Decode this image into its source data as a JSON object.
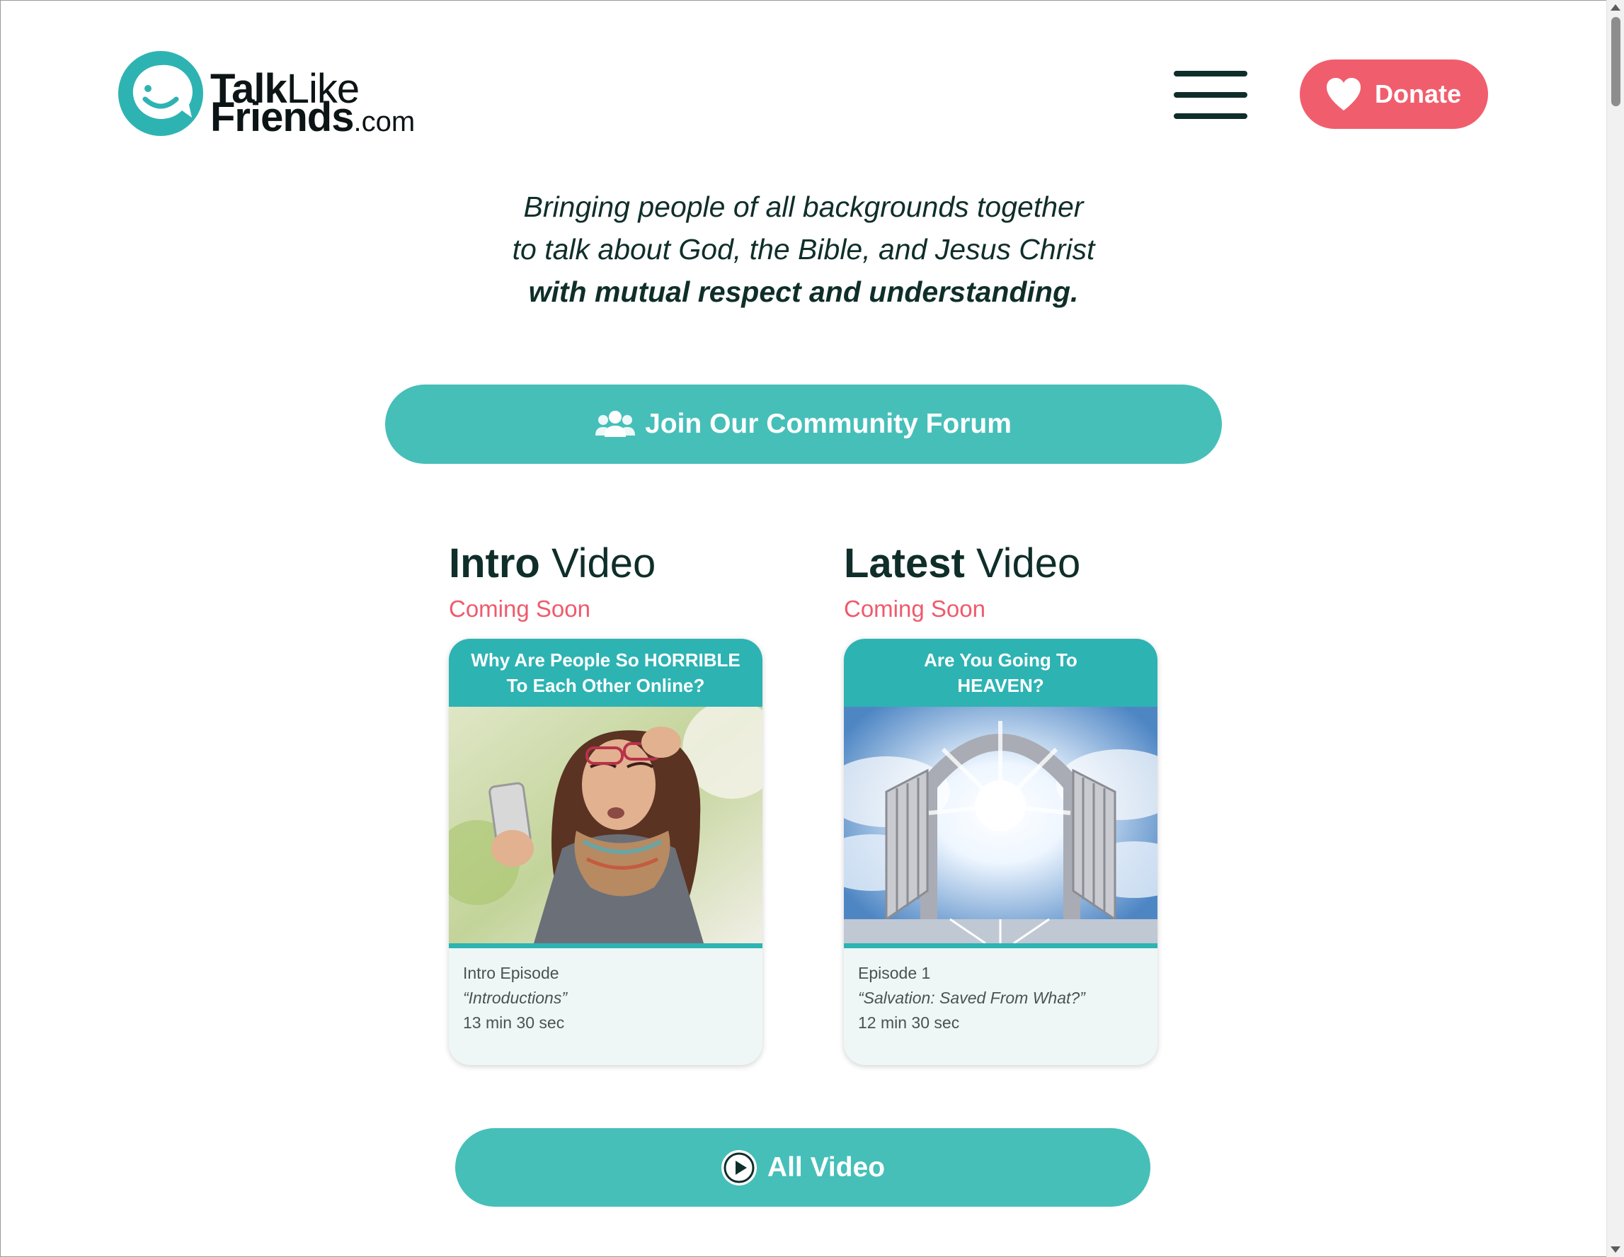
{
  "header": {
    "logo": {
      "word1_bold": "Talk",
      "word1_light": "Like",
      "word2_bold": "Friends",
      "word2_suffix": ".com"
    },
    "menu_icon": "hamburger-menu-icon",
    "donate_label": "Donate"
  },
  "tagline": {
    "line1": "Bringing people of all backgrounds together",
    "line2": "to talk about God, the Bible, and Jesus Christ",
    "line3": "with mutual respect and understanding."
  },
  "forum_button": {
    "label": "Join Our Community Forum",
    "icon": "people-group-icon"
  },
  "videos": [
    {
      "title_bold": "Intro",
      "title_rest": " Video",
      "status": "Coming Soon",
      "thumb_line1_pre": "Why Are People So ",
      "thumb_line1_bold": "HORRIBLE",
      "thumb_line2": "To Each Other Online?",
      "episode": "Intro Episode",
      "episode_title": "“Introductions”",
      "duration": "13 min 30 sec"
    },
    {
      "title_bold": "Latest",
      "title_rest": " Video",
      "status": "Coming Soon",
      "thumb_line1_pre": "Are You Going To",
      "thumb_line1_bold": "",
      "thumb_line2": "HEAVEN?",
      "episode": "Episode 1",
      "episode_title": "“Salvation: Saved From What?”",
      "duration": "12 min 30 sec"
    }
  ],
  "all_button": {
    "label": "All Video",
    "icon": "play-circle-icon"
  },
  "colors": {
    "teal": "#46bfb9",
    "teal_dark": "#2eb3b3",
    "coral": "#f05e6e",
    "ink": "#0f2e2a"
  }
}
